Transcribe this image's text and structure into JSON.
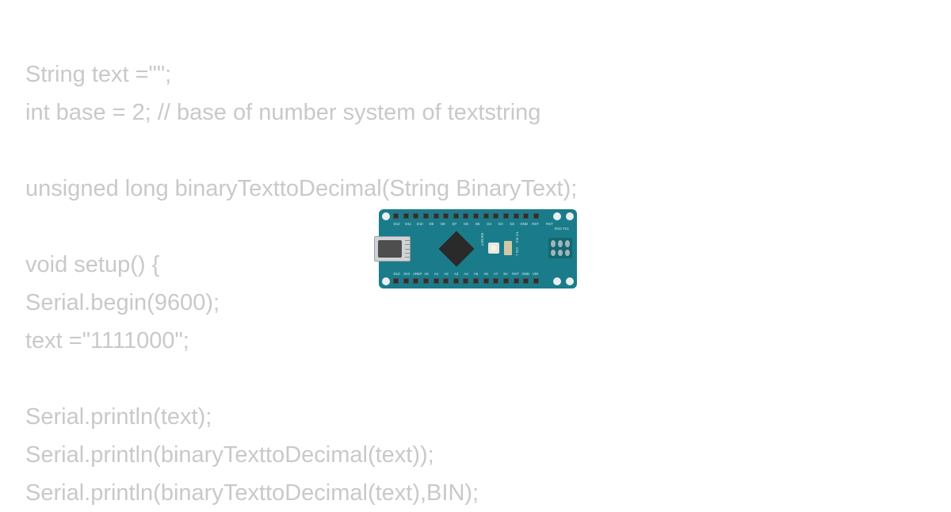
{
  "code": {
    "line1": "String text =\"\";",
    "line2": "int base = 2; // base of number system of textstring",
    "line3": "",
    "line4": "unsigned long binaryTexttoDecimal(String BinaryText);",
    "line5": "",
    "line6": "void setup() {",
    "line7": "Serial.begin(9600);",
    "line8": "text =\"1111000\";",
    "line9": "",
    "line10": "Serial.println(text);",
    "line11": "Serial.println(binaryTexttoDecimal(text));",
    "line12": "Serial.println(binaryTexttoDecimal(text),BIN);"
  },
  "board": {
    "name": "Arduino Nano",
    "top_pins": [
      "D12",
      "D11",
      "D10",
      "D9",
      "D8",
      "D7",
      "D6",
      "D5",
      "D4",
      "D3",
      "D2",
      "GND",
      "RST"
    ],
    "bottom_pins": [
      "D13",
      "3V3",
      "AREF",
      "A0",
      "A1",
      "A2",
      "A3",
      "A4",
      "A5",
      "A6",
      "A7",
      "5V",
      "RST",
      "GND",
      "VIN"
    ],
    "rst_label": "RST",
    "rxtx_label": "RX0 TX1",
    "reset_text": "RESET",
    "txrx_text": "TX RX",
    "onl_text": "ON L"
  }
}
